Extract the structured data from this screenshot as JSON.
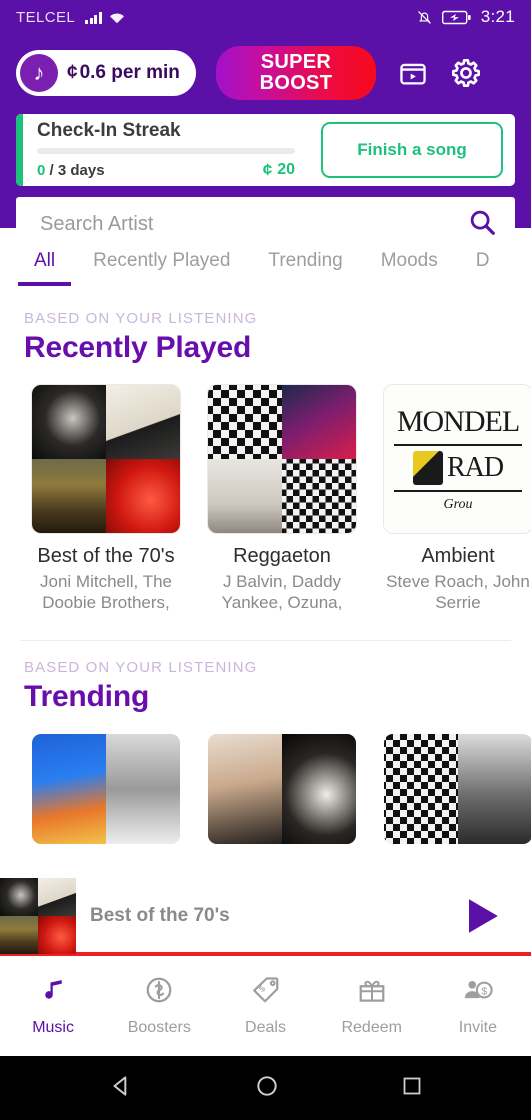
{
  "statusbar": {
    "carrier": "TELCEL",
    "time": "3:21",
    "icons": [
      "signal-bars-icon",
      "wifi-icon",
      "bell-muted-icon",
      "battery-charging-icon"
    ]
  },
  "header": {
    "coin_pill": {
      "icon": "music-note-icon",
      "currency_symbol": "¢",
      "rate": "0.6 per min"
    },
    "super_boost": {
      "line1": "SUPER",
      "line2": "BOOST",
      "gradient_from": "#a211c9",
      "gradient_to": "#f60a1a"
    },
    "video_icon": "video-box-icon",
    "settings_icon": "gear-icon",
    "background": "#5b10a8"
  },
  "streak": {
    "title": "Check-In Streak",
    "progress_percent": 0,
    "days_current": "0",
    "days_total": "/ 3 days",
    "reward_symbol": "¢",
    "reward_amount": "20",
    "button_label": "Finish a song",
    "accent": "#1ec07e"
  },
  "search": {
    "placeholder": "Search Artist",
    "value": "",
    "icon": "search-icon"
  },
  "tabs": {
    "items": [
      {
        "label": "All",
        "active": true
      },
      {
        "label": "Recently Played",
        "active": false
      },
      {
        "label": "Trending",
        "active": false
      },
      {
        "label": "Moods",
        "active": false
      },
      {
        "label": "D",
        "active": false
      }
    ],
    "active_color": "#5b10a8"
  },
  "sections": [
    {
      "eyebrow": "BASED ON YOUR LISTENING",
      "title": "Recently Played",
      "cards": [
        {
          "title": "Best of the 70's",
          "subtitle": "Joni Mitchell, The Doobie Brothers,"
        },
        {
          "title": "Reggaeton",
          "subtitle": "J Balvin, Daddy Yankee, Ozuna,"
        },
        {
          "title": "Ambient",
          "subtitle": "Steve Roach, John Serrie"
        }
      ]
    },
    {
      "eyebrow": "BASED ON YOUR LISTENING",
      "title": "Trending",
      "cards": [
        {
          "title": "",
          "subtitle": ""
        },
        {
          "title": "",
          "subtitle": ""
        },
        {
          "title": "",
          "subtitle": ""
        }
      ]
    }
  ],
  "miniplayer": {
    "title": "Best of the 70's",
    "play_icon": "play-icon",
    "accent_bar": "#f02020"
  },
  "bottomnav": {
    "items": [
      {
        "label": "Music",
        "icon": "music-note-icon",
        "active": true
      },
      {
        "label": "Boosters",
        "icon": "coin-boost-icon",
        "active": false
      },
      {
        "label": "Deals",
        "icon": "price-tag-icon",
        "active": false
      },
      {
        "label": "Redeem",
        "icon": "gift-icon",
        "active": false
      },
      {
        "label": "Invite",
        "icon": "person-dollar-icon",
        "active": false
      }
    ],
    "active_color": "#5b10a8"
  },
  "androidnav": {
    "back": "back-triangle-icon",
    "home": "home-circle-icon",
    "recents": "recents-square-icon"
  }
}
